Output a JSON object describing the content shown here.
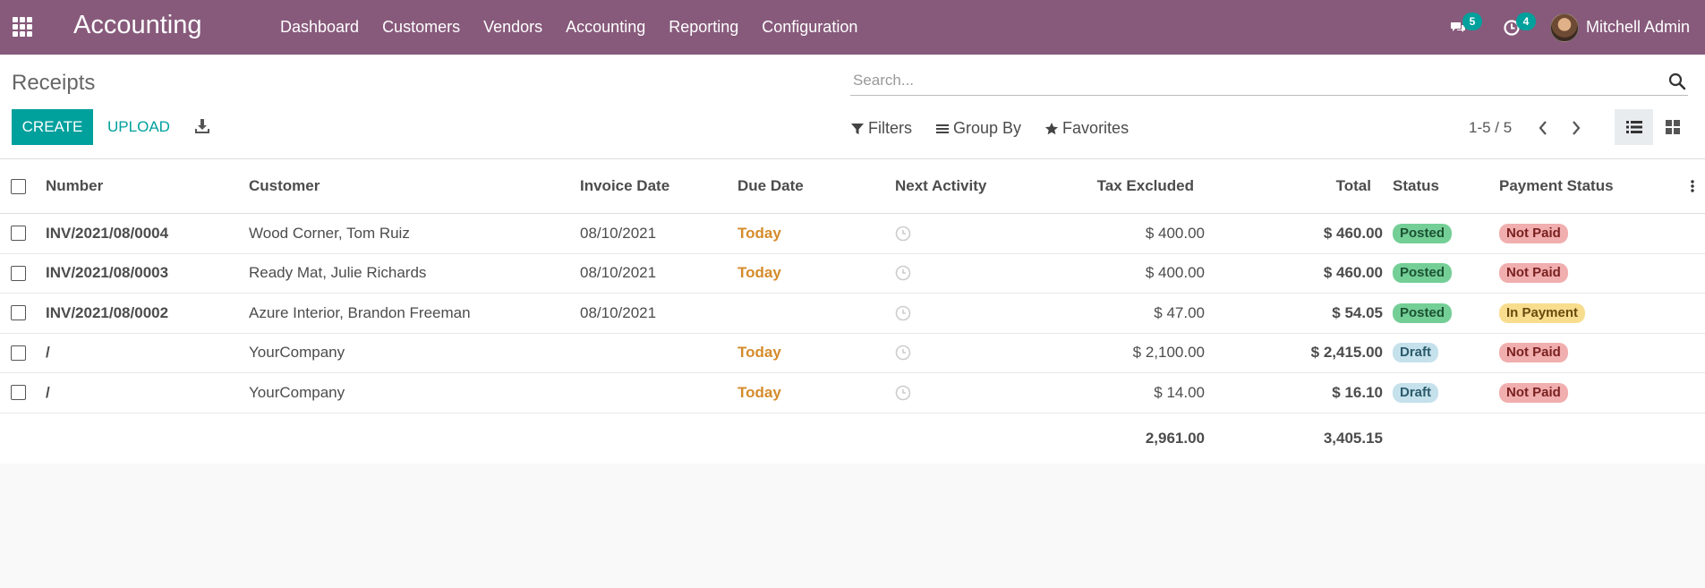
{
  "navbar": {
    "app_title": "Accounting",
    "menu": [
      {
        "label": "Dashboard"
      },
      {
        "label": "Customers"
      },
      {
        "label": "Vendors"
      },
      {
        "label": "Accounting"
      },
      {
        "label": "Reporting"
      },
      {
        "label": "Configuration"
      }
    ],
    "messages_count": "5",
    "activities_count": "4",
    "user_name": "Mitchell Admin",
    "colors": {
      "bar": "#875a7b",
      "badge": "#00a09d"
    }
  },
  "control_panel": {
    "breadcrumb": "Receipts",
    "search_placeholder": "Search...",
    "create_label": "CREATE",
    "upload_label": "UPLOAD",
    "filters_label": "Filters",
    "groupby_label": "Group By",
    "favorites_label": "Favorites",
    "pager": "1-5 / 5"
  },
  "table": {
    "headers": {
      "number": "Number",
      "customer": "Customer",
      "invoice_date": "Invoice Date",
      "due_date": "Due Date",
      "next_activity": "Next Activity",
      "tax_excluded": "Tax Excluded",
      "total": "Total",
      "status": "Status",
      "payment_status": "Payment Status"
    },
    "rows": [
      {
        "number": "INV/2021/08/0004",
        "customer": "Wood Corner, Tom Ruiz",
        "invoice_date": "08/10/2021",
        "due_date": "Today",
        "tax_excluded": "$ 400.00",
        "total": "$ 460.00",
        "status": "Posted",
        "payment_status": "Not Paid"
      },
      {
        "number": "INV/2021/08/0003",
        "customer": "Ready Mat, Julie Richards",
        "invoice_date": "08/10/2021",
        "due_date": "Today",
        "tax_excluded": "$ 400.00",
        "total": "$ 460.00",
        "status": "Posted",
        "payment_status": "Not Paid"
      },
      {
        "number": "INV/2021/08/0002",
        "customer": "Azure Interior, Brandon Freeman",
        "invoice_date": "08/10/2021",
        "due_date": "",
        "tax_excluded": "$ 47.00",
        "total": "$ 54.05",
        "status": "Posted",
        "payment_status": "In Payment"
      },
      {
        "number": "/",
        "customer": "YourCompany",
        "invoice_date": "",
        "due_date": "Today",
        "tax_excluded": "$ 2,100.00",
        "total": "$ 2,415.00",
        "status": "Draft",
        "payment_status": "Not Paid"
      },
      {
        "number": "/",
        "customer": "YourCompany",
        "invoice_date": "",
        "due_date": "Today",
        "tax_excluded": "$ 14.00",
        "total": "$ 16.10",
        "status": "Draft",
        "payment_status": "Not Paid"
      }
    ],
    "totals": {
      "tax_excluded": "2,961.00",
      "total": "3,405.15"
    }
  }
}
